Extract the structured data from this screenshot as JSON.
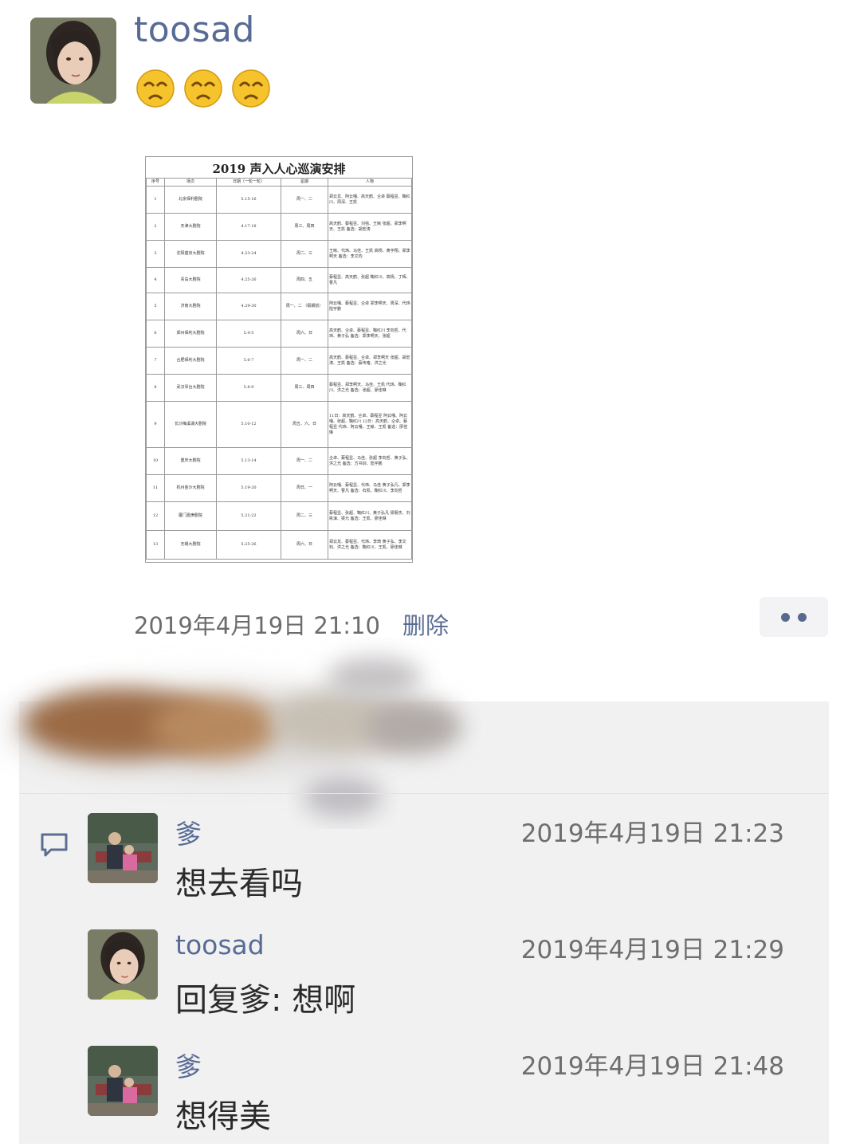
{
  "post": {
    "author": "toosad",
    "emojis": [
      "sad-face-emoji",
      "sad-face-emoji",
      "sad-face-emoji"
    ],
    "image": {
      "title": "2019 声入人心巡演安排",
      "headers": [
        "序号",
        "场次",
        "日期（一轮一轮）",
        "星期",
        "人物"
      ],
      "rows": [
        {
          "no": "1",
          "venue": "北京保利剧院",
          "date": "5.15-16",
          "day": "周一、二",
          "people": "郑云龙、阿云嘎、高天鹤、仝卓 蔡程昱、鞠红川、周深、王凯"
        },
        {
          "no": "2",
          "venue": "天津大剧院",
          "date": "4.17-18",
          "day": "周三、周四",
          "people": "高天鹤、蔡程昱、刘强、王晰 张超、郑李啊天、王凯 备选：胡宏涛"
        },
        {
          "no": "3",
          "venue": "沈阳盛京大剧院",
          "date": "4.23-24",
          "day": "周二、三",
          "people": "王晰、代玮、马佳、王凯 高杨、黄宇翔、郑李啊天 备选：李文钧"
        },
        {
          "no": "4",
          "venue": "青岛大剧院",
          "date": "4.25-26",
          "day": "周四、五",
          "people": "蔡程昱、高天鹤、张超 鞠红川、高杨、丁辉、曹凡"
        },
        {
          "no": "5",
          "venue": "济南大剧院",
          "date": "4.29-30",
          "day": "周一、二 （假期前）",
          "people": "阿云嘎、蔡程昱、仝卓 郑李啊天、周深、代玮 陆宇鹏"
        },
        {
          "no": "6",
          "venue": "郑州保利大剧院",
          "date": "5.4-5",
          "day": "周六、日",
          "people": "高天鹤、仝卓、蔡程昱、鞠红川 李向哲、代玮、黄子弘 备选：郑李啊天、张超"
        },
        {
          "no": "7",
          "venue": "合肥保利大剧院",
          "date": "5.6-7",
          "day": "周一、二",
          "people": "高天鹤、蔡程昱、仝卓、郑李啊天 张超、胡宏涛、王凯 备选：蔡传雍、洪之光"
        },
        {
          "no": "8",
          "venue": "武汉琴台大剧院",
          "date": "5.8-9",
          "day": "周三、周四",
          "people": "蔡程昱、郑李啊天、马佳、王凯 代玮、鞠红川、洪之光 备选：张超、廖佳琳"
        },
        {
          "no": "9",
          "venue": "长沙梅溪湖大剧院",
          "date": "5.10-12",
          "day": "周五、六、日",
          "people": "11日：高天鹤、仝卓、蔡程昱 阿云嘎、阿云嘎、张超、鞠红川 12日：高天鹤、仝卓、蔡程昱 代玮、阿云嘎、王晰、王凯 备选：廖佳琳"
        },
        {
          "no": "10",
          "venue": "重庆大剧院",
          "date": "5.13-14",
          "day": "周一、二",
          "people": "仝卓、蔡程昱、马佳、张超 李向哲、黄子弘、洪之光 备选：方书剑、陆宇鹏"
        },
        {
          "no": "11",
          "venue": "杭州金沙大剧院",
          "date": "5.19-20",
          "day": "周日、一",
          "people": "阿云嘎、蔡程昱、代玮、马佳 黄子弘凡、郑李啊天、曹凡 备选：石凯、鞠红川、李向哲"
        },
        {
          "no": "12",
          "venue": "厦门嘉庚剧院",
          "date": "5.21-22",
          "day": "周二、三",
          "people": "蔡程昱、张超、鞠红川、黄子弘凡 梁朋杰、刘彬濠、梁元 备选：王凯、廖佳琳"
        },
        {
          "no": "13",
          "venue": "无锡大剧院",
          "date": "5.25-26",
          "day": "周六、日",
          "people": "郑云龙、蔡程昱、代玮、李琦 黄子弘、李文钧、洪之光 备选：鞠红川、王凯、廖佳琳"
        }
      ]
    },
    "timestamp": "2019年4月19日 21:10",
    "delete_label": "删除"
  },
  "comments": [
    {
      "name": "爹",
      "time": "2019年4月19日 21:23",
      "text": "想去看吗"
    },
    {
      "name": "toosad",
      "time": "2019年4月19日 21:29",
      "text": "回复爹: 想啊"
    },
    {
      "name": "爹",
      "time": "2019年4月19日 21:48",
      "text": "想得美"
    }
  ],
  "colors": {
    "name_link": "#586b95",
    "panel_bg": "#f1f1f1",
    "timestamp": "#6c6c6c"
  }
}
